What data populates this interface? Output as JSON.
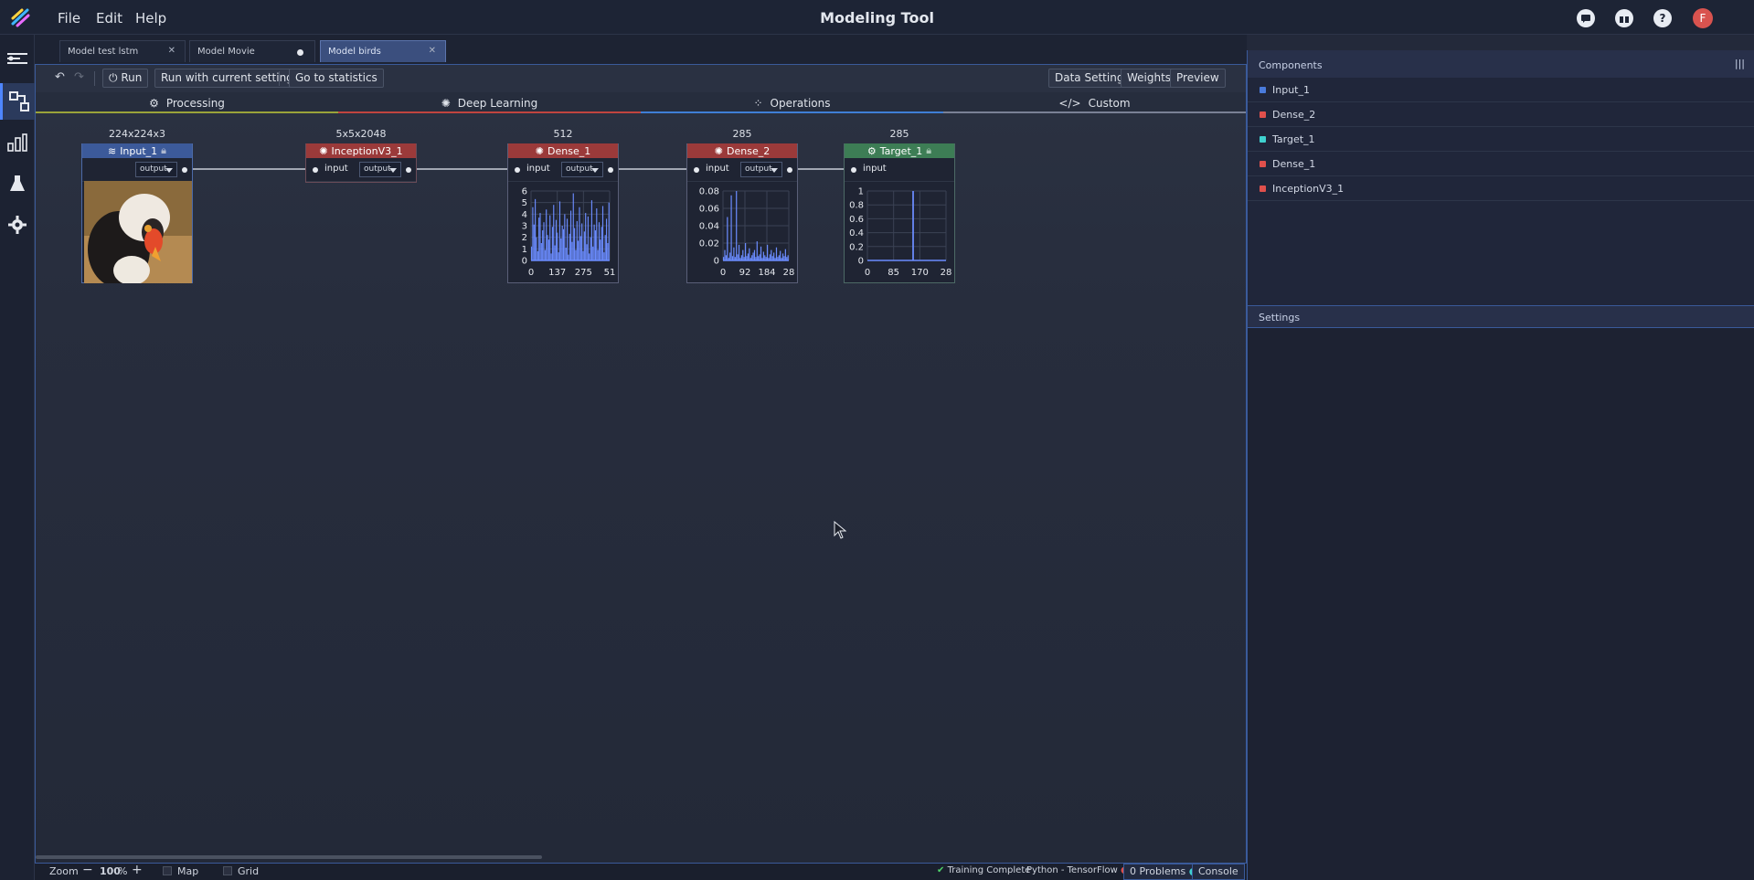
{
  "app": {
    "title": "Modeling Tool",
    "menu": [
      "File",
      "Edit",
      "Help"
    ],
    "user_initial": "F"
  },
  "file_tabs": [
    {
      "label": "Model test lstm",
      "state": "closable"
    },
    {
      "label": "Model Movie",
      "state": "unsaved"
    },
    {
      "label": "Model birds",
      "state": "active"
    }
  ],
  "toolbar": {
    "run": "Run",
    "run_current": "Run with current settings",
    "statistics": "Go to statistics",
    "data_settings": "Data Settings",
    "weights": "Weights",
    "preview": "Preview"
  },
  "categories": [
    {
      "label": "Processing",
      "icon": "gear-icon",
      "color": "#9aa33a"
    },
    {
      "label": "Deep Learning",
      "icon": "brain-icon",
      "color": "#c0443f"
    },
    {
      "label": "Operations",
      "icon": "grid-icon",
      "color": "#3f7fd6"
    },
    {
      "label": "Custom",
      "icon": "code-icon",
      "color": "#7a8195"
    }
  ],
  "nodes": [
    {
      "id": "input",
      "name": "Input_1",
      "dims": "224x224x3",
      "color": "#3c5a9a",
      "locked": true,
      "output": "output"
    },
    {
      "id": "inception",
      "name": "InceptionV3_1",
      "dims": "5x5x2048",
      "color": "#9b3a3a",
      "input": "input",
      "output": "output"
    },
    {
      "id": "dense1",
      "name": "Dense_1",
      "dims": "512",
      "color": "#9b3a3a",
      "input": "input",
      "output": "output"
    },
    {
      "id": "dense2",
      "name": "Dense_2",
      "dims": "285",
      "color": "#9b3a3a",
      "input": "input",
      "output": "output"
    },
    {
      "id": "target",
      "name": "Target_1",
      "dims": "285",
      "color": "#3d7d55",
      "locked": true,
      "input": "input"
    }
  ],
  "chart_data": [
    {
      "type": "bar",
      "node": "Dense_1",
      "ylim": [
        0,
        6
      ],
      "yticks": [
        "6",
        "5",
        "4",
        "3",
        "2",
        "1",
        "0"
      ],
      "xticks": [
        "0",
        "137",
        "275",
        "51"
      ],
      "values": [
        1.2,
        4.6,
        3.1,
        5.3,
        2.0,
        0.8,
        3.7,
        4.1,
        1.5,
        2.6,
        3.3,
        0.9,
        4.4,
        2.2,
        1.8,
        3.9,
        0.6,
        2.9,
        4.8,
        1.3,
        3.5,
        2.4,
        0.7,
        5.1,
        1.9,
        3.0,
        2.7,
        4.0,
        1.1,
        3.6,
        0.5,
        2.3,
        4.3,
        1.6,
        5.8,
        2.8,
        0.9,
        3.4,
        1.7,
        4.6,
        2.1,
        3.2,
        0.8,
        2.5,
        4.1,
        1.4,
        3.8,
        0.6,
        2.0,
        5.2,
        1.2,
        3.1,
        2.6,
        4.5,
        0.9,
        3.3,
        1.8,
        2.9,
        4.7,
        0.7,
        2.2,
        3.6,
        1.5,
        5.0
      ]
    },
    {
      "type": "bar",
      "node": "Dense_2",
      "ylim": [
        0,
        0.08
      ],
      "yticks": [
        "0.08",
        "0.06",
        "0.04",
        "0.02",
        "0"
      ],
      "xticks": [
        "0",
        "92",
        "184",
        "28"
      ],
      "values": [
        0.004,
        0.012,
        0.006,
        0.05,
        0.003,
        0.009,
        0.075,
        0.005,
        0.015,
        0.004,
        0.08,
        0.007,
        0.018,
        0.003,
        0.006,
        0.012,
        0.004,
        0.02,
        0.005,
        0.008,
        0.014,
        0.003,
        0.006,
        0.009,
        0.012,
        0.004,
        0.022,
        0.005,
        0.007,
        0.016,
        0.003,
        0.01,
        0.006,
        0.004,
        0.018,
        0.003,
        0.007,
        0.012,
        0.005,
        0.009,
        0.003,
        0.015,
        0.004,
        0.006,
        0.011,
        0.003,
        0.008,
        0.005,
        0.013,
        0.004,
        0.006
      ]
    },
    {
      "type": "bar",
      "node": "Target_1",
      "ylim": [
        0,
        1
      ],
      "yticks": [
        "1",
        "0.8",
        "0.6",
        "0.4",
        "0.2",
        "0"
      ],
      "xticks": [
        "0",
        "85",
        "170",
        "28"
      ],
      "values": [
        0,
        0,
        0,
        0,
        0,
        0,
        0,
        0,
        0,
        0,
        0,
        0,
        0,
        0,
        0,
        0,
        0,
        0,
        0,
        0,
        0,
        0,
        0,
        0,
        1,
        0,
        0,
        0,
        0,
        0,
        0,
        0,
        0,
        0,
        0,
        0,
        0,
        0,
        0,
        0,
        0,
        0
      ]
    }
  ],
  "components": [
    {
      "label": "Input_1",
      "color": "#4a7bdc"
    },
    {
      "label": "Dense_2",
      "color": "#e0504c"
    },
    {
      "label": "Target_1",
      "color": "#3fd1cf"
    },
    {
      "label": "Dense_1",
      "color": "#e0504c"
    },
    {
      "label": "InceptionV3_1",
      "color": "#e0504c"
    }
  ],
  "panels": {
    "components": "Components",
    "settings": "Settings"
  },
  "bottom_bar": {
    "zoom_label": "Zoom",
    "zoom_value": "100",
    "zoom_unit": "%",
    "map": "Map",
    "grid": "Grid",
    "status": "Training Complete",
    "runtime": "Python - TensorFlow",
    "problems": "0 Problems",
    "console": "Console"
  }
}
